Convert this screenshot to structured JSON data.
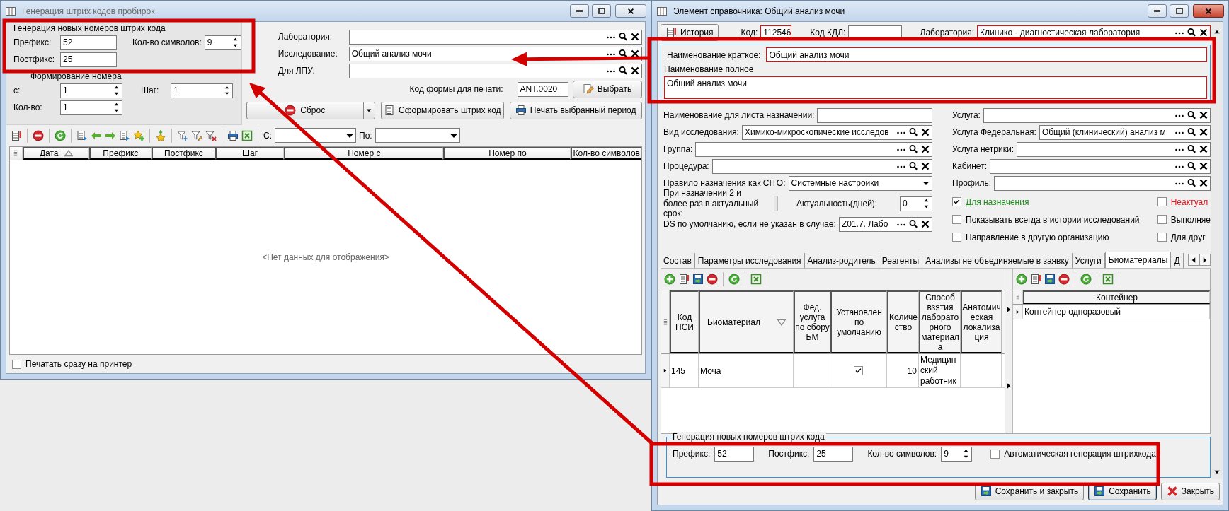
{
  "left_window": {
    "title": "Генерация штрих кодов пробирок",
    "active": false,
    "barcode_group": {
      "title": "Генерация новых номеров штрих кода",
      "prefix": {
        "label": "Префикс:",
        "value": "52"
      },
      "postfix": {
        "label": "Постфикс:",
        "value": "25"
      },
      "symbols": {
        "label": "Кол-во символов:",
        "value": "9"
      }
    },
    "numbering_group": {
      "title": "Формирование номера",
      "from": {
        "label": "с:",
        "value": "1"
      },
      "step": {
        "label": "Шаг:",
        "value": "1"
      },
      "count": {
        "label": "Кол-во:",
        "value": "1"
      }
    },
    "lookups": [
      {
        "label": "Лаборатория:"
      },
      {
        "label": "Исследование:",
        "value": "Общий анализ мочи"
      },
      {
        "label": "Для ЛПУ:"
      }
    ],
    "print_form": {
      "label": "Код формы для печати:",
      "value": "ANT.0020",
      "button": "Выбрать"
    },
    "actions": {
      "reset": "Сброс",
      "generate": "Сформировать штрих код",
      "print": "Печать выбранный период"
    },
    "filter": {
      "from_label": "С:",
      "to_label": "По:"
    },
    "table": {
      "columns": [
        {
          "label": "Дата",
          "sorted_ascending": true
        },
        {
          "label": "Префикс"
        },
        {
          "label": "Постфикс"
        },
        {
          "label": "Шаг"
        },
        {
          "label": "Номер с"
        },
        {
          "label": "Номер по"
        },
        {
          "label": "Кол-во символов"
        }
      ],
      "empty_text": "<Нет данных для отображения>"
    },
    "print_now": {
      "label": "Печатать сразу на принтер",
      "checked": false
    }
  },
  "right_window": {
    "title": "Элемент справочника: Общий анализ мочи",
    "active": true,
    "history_button": "История",
    "code": {
      "label": "Код:",
      "value": "112546",
      "required": true
    },
    "kdl_code": {
      "label": "Код КДЛ:",
      "required": false
    },
    "laboratory": {
      "label": "Лаборатория:",
      "value": "Клинико - диагностическая лаборатория",
      "required": true
    },
    "short_name": {
      "label": "Наименование краткое:",
      "value": "Общий анализ мочи",
      "required": true
    },
    "full_name": {
      "label": "Наименование полное",
      "value": "Общий анализ мочи",
      "required": true
    },
    "left_fields": [
      {
        "kind": "text",
        "label": "Наименование для листа назначении:"
      },
      {
        "kind": "lookup",
        "label": "Вид исследования:",
        "value": "Химико-микроскопические исследов"
      },
      {
        "kind": "lookup",
        "label": "Группа:"
      },
      {
        "kind": "lookup",
        "label": "Процедура:"
      },
      {
        "kind": "combo",
        "label": "Правило назначения как CITO:",
        "value": "Системные настройки"
      },
      {
        "kind": "repeat",
        "label": "При назначении 2 и более раз в актуальный срок:",
        "sub_label": "Актуальность(дней):",
        "value": "0"
      },
      {
        "kind": "lookup",
        "label": "DS по умолчанию, если не указан в случае:",
        "value": "Z01.7. Лабо"
      }
    ],
    "right_fields": [
      {
        "kind": "lookup",
        "label": "Услуга:"
      },
      {
        "kind": "lookup",
        "label": "Услуга Федеральная:",
        "value": "Общий (клинический) анализ м"
      },
      {
        "kind": "lookup",
        "label": "Услуга нетрики:"
      },
      {
        "kind": "lookup",
        "label": "Кабинет:"
      },
      {
        "kind": "lookup",
        "label": "Профиль:"
      }
    ],
    "flags": [
      {
        "label": "Для назначения",
        "checked": true,
        "color": "#1e8c1e"
      },
      {
        "label": "Неактуал",
        "checked": false,
        "color": "#e8141c"
      },
      {
        "label": "Показывать всегда в истории исследований",
        "checked": false,
        "color": "#000000"
      },
      {
        "label": "Выполняе",
        "checked": false,
        "color": "#000000"
      },
      {
        "label": "Направление в другую организацию",
        "checked": false,
        "color": "#000000"
      },
      {
        "label": "Для друг",
        "checked": false,
        "color": "#000000"
      }
    ],
    "tabs": [
      {
        "label": "Состав",
        "selected": false
      },
      {
        "label": "Параметры исследования",
        "selected": false
      },
      {
        "label": "Анализ-родитель",
        "selected": false
      },
      {
        "label": "Реагенты",
        "selected": false
      },
      {
        "label": "Анализы не объединяемые в заявку",
        "selected": false
      },
      {
        "label": "Услуги",
        "selected": false
      },
      {
        "label": "Биоматериалы",
        "selected": true
      },
      {
        "label": "Д",
        "selected": false
      }
    ],
    "biomaterials": {
      "columns": [
        {
          "label": "Код НСИ"
        },
        {
          "label": "Биоматериал",
          "sorted_descending": true
        },
        {
          "label": "Фед. услуга по сбору БМ"
        },
        {
          "label": "Установлен по умолчанию"
        },
        {
          "label": "Количество"
        },
        {
          "label": "Способ взятия лабораторного материала"
        },
        {
          "label": "Анатомическая локализация"
        }
      ],
      "rows": [
        {
          "code": "145",
          "name": "Моча",
          "default": true,
          "quantity": "10",
          "method": "Медицинский работник",
          "selected": true
        }
      ]
    },
    "containers": {
      "column": "Контейнер",
      "rows": [
        {
          "name": "Контейнер одноразовый",
          "selected": true
        }
      ]
    },
    "barcode_group": {
      "title": "Генерация новых номеров штрих кода",
      "prefix": {
        "label": "Префикс:",
        "value": "52"
      },
      "postfix": {
        "label": "Постфикс:",
        "value": "25"
      },
      "symbols": {
        "label": "Кол-во символов:",
        "value": "9"
      },
      "auto": {
        "label": "Автоматическая генерация штрихкода",
        "checked": false
      }
    },
    "buttons": [
      {
        "kind": "save_close",
        "label": "Сохранить и закрыть",
        "default": false
      },
      {
        "kind": "save",
        "label": "Сохранить",
        "default": true
      },
      {
        "kind": "close",
        "label": "Закрыть",
        "default": false
      }
    ]
  }
}
